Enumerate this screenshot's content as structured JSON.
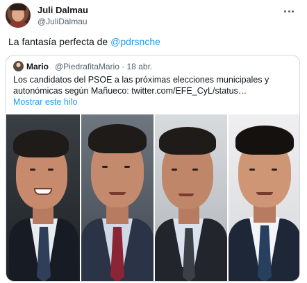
{
  "author": {
    "name": "Juli Dalmau",
    "handle": "@JuliDalmau"
  },
  "tweet": {
    "text_prefix": "La fantasía perfecta de ",
    "mention": "@pdrsnche"
  },
  "quote": {
    "name": "Mario",
    "handle_date": "@PiedrafitaMario · 18 abr.",
    "text_line1": "Los candidatos del PSOE a las próximas elecciones municipales y",
    "text_line2": "autonómicas según Mañueco:  twitter.com/EFE_CyL/status…",
    "show_thread": "Mostrar este hilo"
  },
  "colors": {
    "accent": "#1d9bf0",
    "secondary_text": "#536471",
    "border": "#cfd9de"
  },
  "icons": {
    "more": "more-options-icon"
  },
  "photos": [
    {
      "name": "photo-1"
    },
    {
      "name": "photo-2"
    },
    {
      "name": "photo-3"
    },
    {
      "name": "photo-4"
    }
  ]
}
